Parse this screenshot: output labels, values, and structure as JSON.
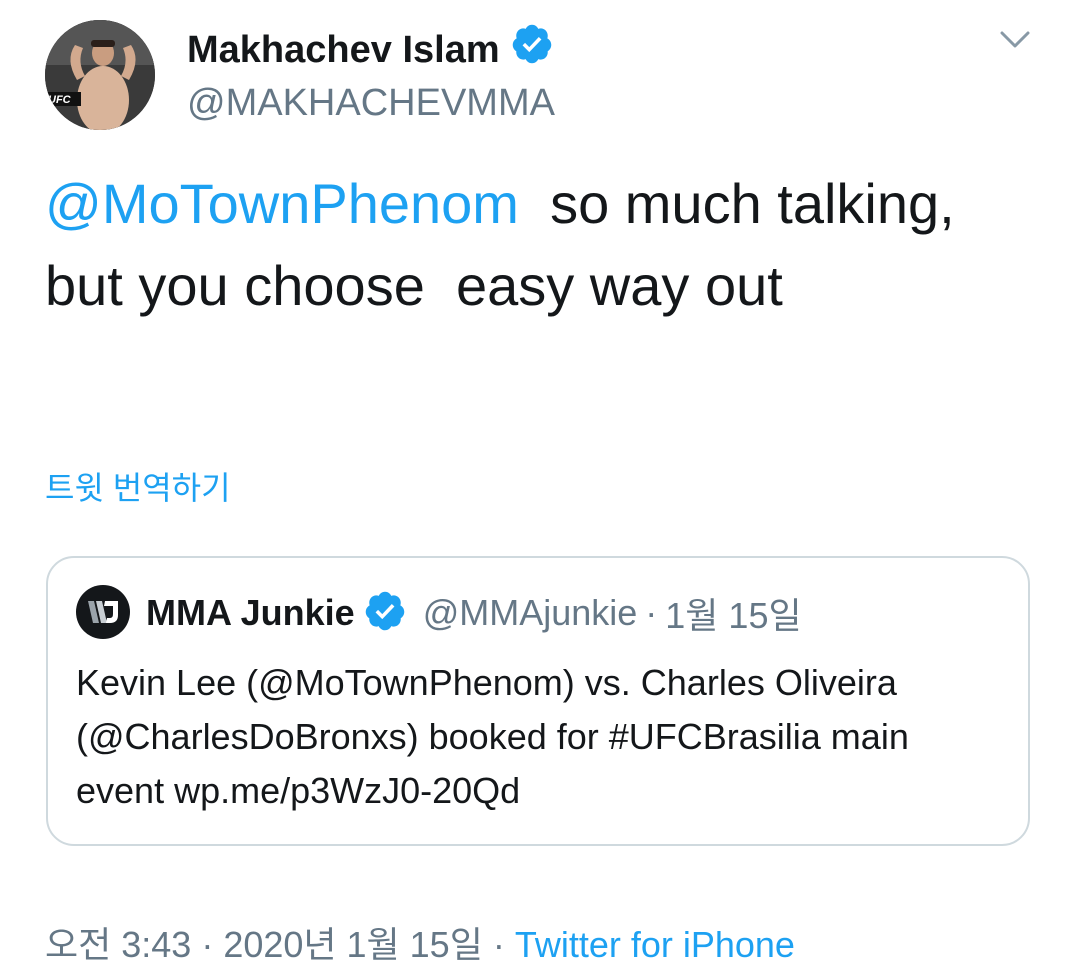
{
  "author": {
    "display_name": "Makhachev Islam",
    "handle": "@MAKHACHEVMMA",
    "avatar_logo_text": "UFC"
  },
  "tweet": {
    "mention": "@MoTownPhenom",
    "text": "  so much talking, but you choose  easy way out",
    "translate_label": "트윗 번역하기"
  },
  "quoted_tweet": {
    "display_name": "MMA Junkie",
    "handle": "@MMAjunkie",
    "separator": "·",
    "date": "1월 15일",
    "text": "Kevin Lee (@MoTownPhenom) vs. Charles Oliveira (@CharlesDoBronxs) booked for #UFCBrasilia main event wp.me/p3WzJ0-20Qd"
  },
  "footer": {
    "time": "오전 3:43",
    "separator1": " · ",
    "date": "2020년 1월 15일",
    "separator2": " · ",
    "source": "Twitter for iPhone"
  },
  "colors": {
    "link": "#1da1f2",
    "text": "#14171a",
    "secondary": "#657786",
    "border": "#cfd9de"
  },
  "icons": {
    "verified": "verified-badge-icon",
    "menu": "chevron-down-icon"
  }
}
